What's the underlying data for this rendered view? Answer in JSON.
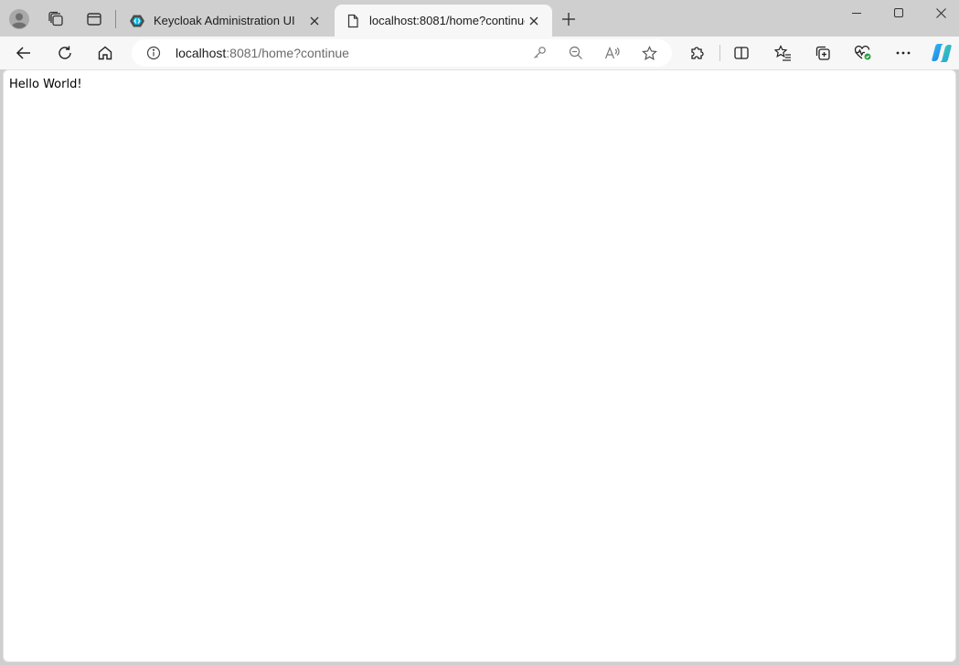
{
  "tabs": [
    {
      "title": "Keycloak Administration UI",
      "active": false
    },
    {
      "title": "localhost:8081/home?continue",
      "active": true
    }
  ],
  "address_bar": {
    "host": "localhost",
    "rest": ":8081/home?continue"
  },
  "page": {
    "body_text": "Hello World!"
  },
  "icons": {
    "profile": "avatar-icon",
    "workspaces": "workspaces-icon",
    "tab_actions": "tab-actions-icon",
    "keycloak_favicon": "keycloak-icon",
    "page_favicon": "page-icon",
    "close": "close-icon",
    "new_tab": "plus-icon",
    "back": "arrow-left-icon",
    "refresh": "refresh-icon",
    "home": "home-icon",
    "site_info": "info-icon",
    "password": "key-icon",
    "zoom_out": "zoom-out-icon",
    "read_aloud": "read-aloud-icon",
    "favorite": "star-icon",
    "extensions": "puzzle-icon",
    "split_screen": "split-screen-icon",
    "favorites": "favorites-icon",
    "collections": "collections-icon",
    "browser_essentials": "heart-pulse-icon",
    "more": "more-icon",
    "copilot": "copilot-icon"
  },
  "colors": {
    "frame": "#cfcfcf",
    "toolbar": "#f7f7f7",
    "page_background": "#ffffff",
    "keycloak_accent": "#00b8e3",
    "health_badge": "#2ea043"
  }
}
